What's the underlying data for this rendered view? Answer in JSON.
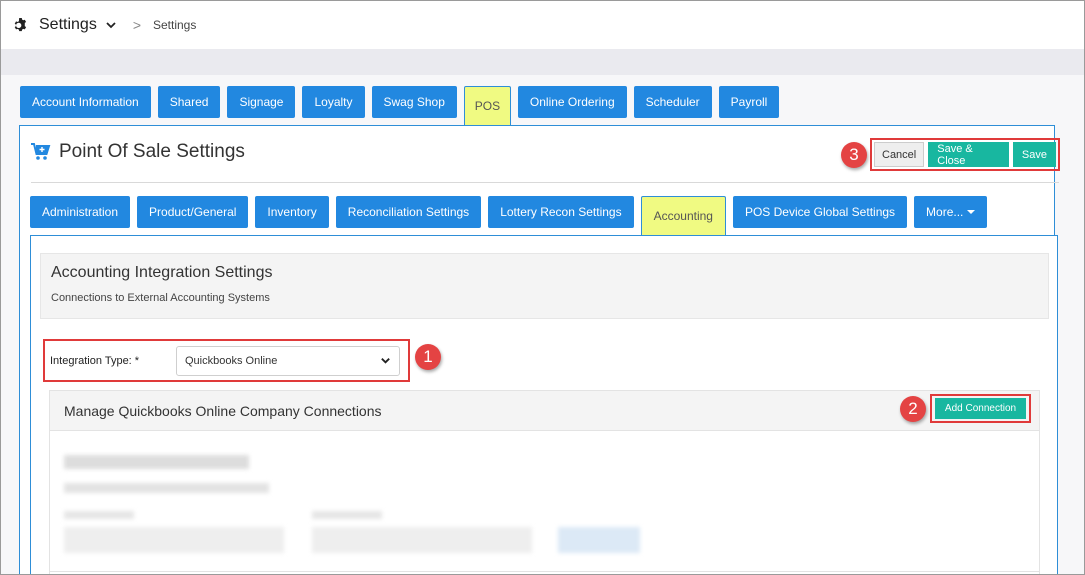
{
  "topbar": {
    "title": "Settings",
    "breadcrumb_sep": ">",
    "breadcrumb": "Settings"
  },
  "main_tabs": [
    {
      "label": "Account Information",
      "active": false
    },
    {
      "label": "Shared",
      "active": false
    },
    {
      "label": "Signage",
      "active": false
    },
    {
      "label": "Loyalty",
      "active": false
    },
    {
      "label": "Swag Shop",
      "active": false
    },
    {
      "label": "POS",
      "active": true
    },
    {
      "label": "Online Ordering",
      "active": false
    },
    {
      "label": "Scheduler",
      "active": false
    },
    {
      "label": "Payroll",
      "active": false
    }
  ],
  "pos": {
    "title": "Point Of Sale Settings",
    "actions": {
      "cancel": "Cancel",
      "save_close": "Save & Close",
      "save": "Save"
    }
  },
  "sub_tabs": [
    {
      "label": "Administration",
      "active": false
    },
    {
      "label": "Product/General",
      "active": false
    },
    {
      "label": "Inventory",
      "active": false
    },
    {
      "label": "Reconciliation Settings",
      "active": false
    },
    {
      "label": "Lottery Recon Settings",
      "active": false
    },
    {
      "label": "Accounting",
      "active": true
    },
    {
      "label": "POS Device Global Settings",
      "active": false
    },
    {
      "label": "More...",
      "active": false
    }
  ],
  "accounting": {
    "heading": "Accounting Integration Settings",
    "subheading": "Connections to External Accounting Systems",
    "integration_label": "Integration Type: *",
    "integration_value": "Quickbooks Online",
    "connections_title": "Manage Quickbooks Online Company Connections",
    "add_connection": "Add Connection"
  },
  "callouts": {
    "one": "1",
    "two": "2",
    "three": "3"
  },
  "colors": {
    "tab_blue": "#2288e0",
    "active_tab": "#f0fa82",
    "teal": "#18b7a0",
    "callout_red": "#e44343"
  }
}
